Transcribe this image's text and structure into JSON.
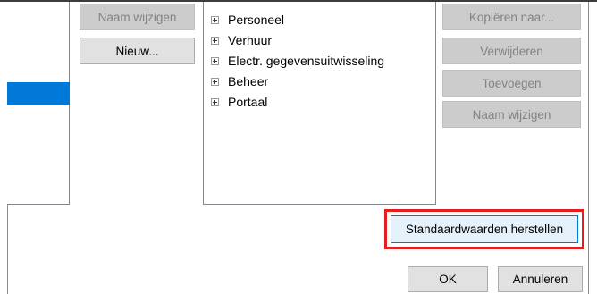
{
  "left_buttons": {
    "rename_label": "Naam wijzigen",
    "new_label": "Nieuw..."
  },
  "tree": {
    "items": [
      {
        "label": "Personeel"
      },
      {
        "label": "Verhuur"
      },
      {
        "label": "Electr. gegevensuitwisseling"
      },
      {
        "label": "Beheer"
      },
      {
        "label": "Portaal"
      }
    ]
  },
  "right_buttons": {
    "copy_label": "Kopiëren naar...",
    "delete_label": "Verwijderen",
    "add_label": "Toevoegen",
    "rename_label": "Naam wijzigen"
  },
  "footer": {
    "restore_defaults_label": "Standaardwaarden herstellen",
    "ok_label": "OK",
    "cancel_label": "Annuleren"
  },
  "colors": {
    "selection": "#0078d7",
    "highlight": "#e41d1d"
  }
}
